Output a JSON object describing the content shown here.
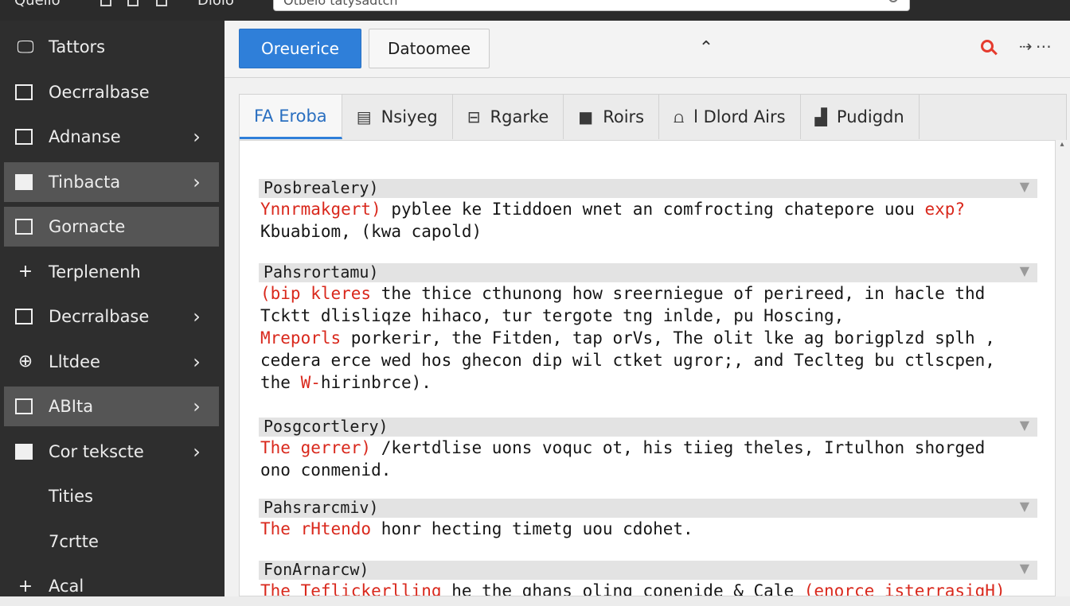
{
  "topbar": {
    "app_label": "Quelio",
    "tab_label": "Diolo",
    "search_value": "Otbelo tatysadtch"
  },
  "sidebar": {
    "items": [
      {
        "label": "Tattors",
        "icon": "monitor-icon",
        "chevron": false,
        "active": false
      },
      {
        "label": "Oecrralbase",
        "icon": "folder-icon",
        "chevron": false,
        "active": false
      },
      {
        "label": "Adnanse",
        "icon": "square-icon",
        "chevron": true,
        "active": false
      },
      {
        "label": "Tinbacta",
        "icon": "image-icon",
        "chevron": true,
        "active": true
      },
      {
        "label": "Gornacte",
        "icon": "export-icon",
        "chevron": false,
        "active": true
      },
      {
        "label": "Terplenenh",
        "icon": "plus-icon",
        "chevron": false,
        "active": false
      },
      {
        "label": "Decrralbase",
        "icon": "folder-icon",
        "chevron": true,
        "active": false
      },
      {
        "label": "Lltdee",
        "icon": "globe-icon",
        "chevron": true,
        "active": false
      },
      {
        "label": "ABIta",
        "icon": "layout-icon",
        "chevron": true,
        "active": true
      },
      {
        "label": "Cor tekscte",
        "icon": "chart-icon",
        "chevron": true,
        "active": false
      },
      {
        "label": "Tities",
        "icon": "",
        "chevron": false,
        "active": false
      },
      {
        "label": "7crtte",
        "icon": "",
        "chevron": false,
        "active": false
      },
      {
        "label": "Acal",
        "icon": "plus-icon",
        "chevron": false,
        "active": false
      }
    ]
  },
  "toolbar": {
    "primary_label": "Oreuerice",
    "secondary_label": "Datoomee",
    "accent_color": "#2f7fd9",
    "search_color": "#e53b2e"
  },
  "tabs": [
    {
      "label": "FA Eroba",
      "icon": "",
      "active": true
    },
    {
      "label": "Nsiyeg",
      "icon": "document-icon",
      "active": false
    },
    {
      "label": "Rgarke",
      "icon": "lock-icon",
      "active": false
    },
    {
      "label": "Roirs",
      "icon": "box-icon",
      "active": false
    },
    {
      "label": "l Dlord Airs",
      "icon": "bars-icon",
      "active": false
    },
    {
      "label": "Pudigdn",
      "icon": "building-icon",
      "active": false
    }
  ],
  "sections": [
    {
      "heading": "Posbrealery)",
      "lines": [
        [
          {
            "t": "Ynnrmakgert) ",
            "red": true
          },
          {
            "t": "pyblee ke Itiddoen wnet an comfrocting chatepore uou ",
            "red": false
          },
          {
            "t": "exp?",
            "red": true
          }
        ],
        [
          {
            "t": "Kbuabiom, (kwa capold)",
            "red": false
          }
        ]
      ]
    },
    {
      "heading": "Pahsrortamu)",
      "lines": [
        [
          {
            "t": "(bip kleres ",
            "red": true
          },
          {
            "t": "the thice cthunong how sreerniegue of perireed, in hacle thd",
            "red": false
          }
        ],
        [
          {
            "t": "Tcktt dlisliqze hihaco, tur tergote tng inlde, pu Hoscing,",
            "red": false
          }
        ],
        [
          {
            "t": "Mreporls ",
            "red": true
          },
          {
            "t": "porkerir, the Fitden, tap orVs, The olit lke ag borigplzd splh ,",
            "red": false
          }
        ],
        [
          {
            "t": "cedera erce wed hos ghecon dip wil ctket ugror;, and Teclteg bu ctlscpen,",
            "red": false
          }
        ],
        [
          {
            "t": "the ",
            "red": false
          },
          {
            "t": "W-",
            "red": true
          },
          {
            "t": "hirinbrce).",
            "red": false
          }
        ]
      ]
    },
    {
      "heading": "Posgcortlery)",
      "lines": [
        [
          {
            "t": "The gerrer) ",
            "red": true
          },
          {
            "t": "/kertdlise uons voquc ot, his tiieg theles, Irtulhon shorged",
            "red": false
          }
        ],
        [
          {
            "t": "ono conmenid.",
            "red": false
          }
        ]
      ]
    },
    {
      "heading": "Pahsrarcmiv)",
      "lines": [
        [
          {
            "t": "The rHtendo ",
            "red": true
          },
          {
            "t": "honr hecting timetg uou cdohet.",
            "red": false
          }
        ]
      ]
    },
    {
      "heading": "FonArnarcw)",
      "lines": [
        [
          {
            "t": "The Teflickerlling ",
            "red": true
          },
          {
            "t": "he the ghans oling conenide & Cale ",
            "red": false
          },
          {
            "t": "(enorce isterrasigH)",
            "red": true
          }
        ]
      ]
    }
  ]
}
